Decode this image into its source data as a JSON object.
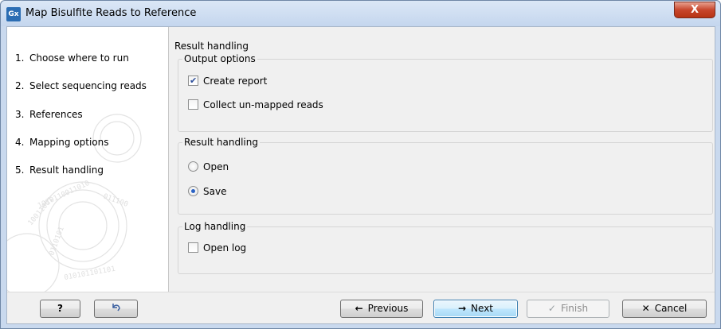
{
  "window": {
    "title": "Map Bisulfite Reads to Reference",
    "app_icon_text": "Gx",
    "close_glyph": "X"
  },
  "steps": [
    {
      "num": "1.",
      "label": "Choose where to run"
    },
    {
      "num": "2.",
      "label": "Select sequencing reads"
    },
    {
      "num": "3.",
      "label": "References"
    },
    {
      "num": "4.",
      "label": "Mapping options"
    },
    {
      "num": "5.",
      "label": "Result handling"
    }
  ],
  "content": {
    "title": "Result handling",
    "output_options": {
      "legend": "Output options",
      "create_report": {
        "label": "Create report",
        "checked": true
      },
      "collect_unmapped": {
        "label": "Collect un-mapped reads",
        "checked": false
      }
    },
    "result_handling": {
      "legend": "Result handling",
      "open": {
        "label": "Open",
        "selected": false
      },
      "save": {
        "label": "Save",
        "selected": true
      }
    },
    "log_handling": {
      "legend": "Log handling",
      "open_log": {
        "label": "Open log",
        "checked": false
      }
    }
  },
  "footer": {
    "help_label": "?",
    "previous_label": "Previous",
    "next_label": "Next",
    "finish_label": "Finish",
    "cancel_label": "Cancel",
    "previous_icon": "←",
    "next_icon": "→",
    "finish_icon": "✓",
    "cancel_icon": "✕"
  },
  "colors": {
    "accent": "#2b6db3",
    "close": "#c7462c"
  }
}
